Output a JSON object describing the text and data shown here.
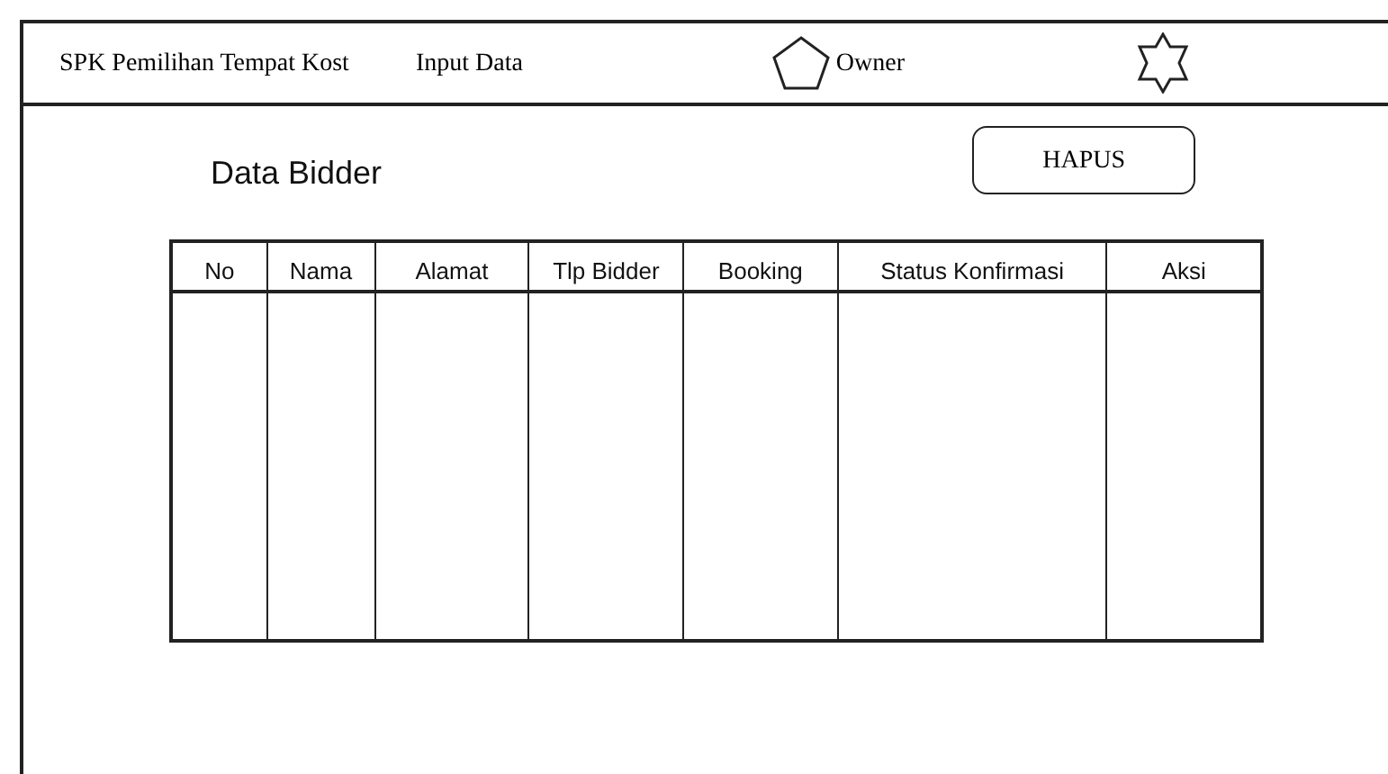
{
  "header": {
    "app_title": "SPK Pemilihan Tempat Kost",
    "nav_link": "Input Data",
    "user": "Owner"
  },
  "page": {
    "title": "Data Bidder",
    "delete_button": "HAPUS"
  },
  "table": {
    "columns": [
      "No",
      "Nama",
      "Alamat",
      "Tlp Bidder",
      "Booking",
      "Status Konfirmasi",
      "Aksi"
    ]
  }
}
